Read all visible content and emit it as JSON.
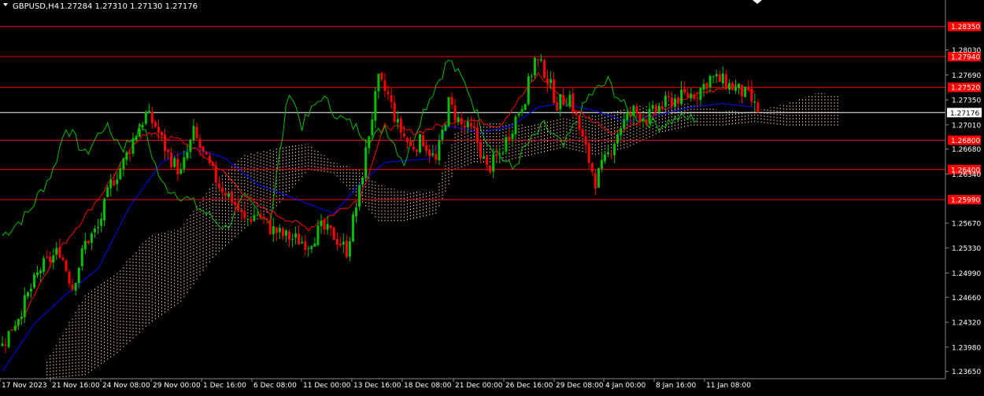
{
  "header": {
    "symbol": "GBPUSD,H4",
    "ohlc": "1.27284 1.27310 1.27130 1.27176"
  },
  "colors": {
    "background": "#000000",
    "bull": "#00c000",
    "bear": "#ff0000",
    "tenkan": "#ff0000",
    "kijun": "#0000ff",
    "chikou": "#00c000",
    "cloud": "#ffd2b4",
    "level": "#ff0000",
    "price_line": "#ffffff",
    "axis_text": "#ffffff"
  },
  "chart_data": {
    "type": "candlestick",
    "y_range": [
      1.2355,
      1.2855
    ],
    "price_ticks": [
      "1.28030",
      "1.27690",
      "1.27350",
      "1.27010",
      "1.26680",
      "1.26340",
      "1.25670",
      "1.25330",
      "1.24990",
      "1.24660",
      "1.24320",
      "1.23980",
      "1.23650"
    ],
    "levels": [
      {
        "price": 1.2835,
        "label": "1.28350"
      },
      {
        "price": 1.2794,
        "label": "1.27940"
      },
      {
        "price": 1.2752,
        "label": "1.27520"
      },
      {
        "price": 1.268,
        "label": "1.26800"
      },
      {
        "price": 1.264,
        "label": "1.26400"
      },
      {
        "price": 1.2599,
        "label": "1.25990"
      }
    ],
    "current_price": {
      "price": 1.27176,
      "label": "1.27176"
    },
    "time_labels": [
      "17 Nov 2023",
      "21 Nov 16:00",
      "24 Nov 08:00",
      "29 Nov 00:00",
      "1 Dec 16:00",
      "6 Dec 08:00",
      "11 Dec 00:00",
      "13 Dec 16:00",
      "18 Dec 08:00",
      "21 Dec 00:00",
      "26 Dec 16:00",
      "29 Dec 08:00",
      "4 Jan 00:00",
      "8 Jan 16:00",
      "11 Jan 08:00"
    ],
    "anchors": [
      [
        0,
        1.24
      ],
      [
        6,
        1.245
      ],
      [
        12,
        1.2505
      ],
      [
        18,
        1.253
      ],
      [
        22,
        1.248
      ],
      [
        26,
        1.254
      ],
      [
        30,
        1.256
      ],
      [
        34,
        1.262
      ],
      [
        38,
        1.265
      ],
      [
        42,
        1.269
      ],
      [
        45,
        1.2715
      ],
      [
        48,
        1.27
      ],
      [
        52,
        1.266
      ],
      [
        56,
        1.2635
      ],
      [
        60,
        1.269
      ],
      [
        64,
        1.265
      ],
      [
        68,
        1.262
      ],
      [
        72,
        1.26
      ],
      [
        76,
        1.257
      ],
      [
        80,
        1.258
      ],
      [
        84,
        1.256
      ],
      [
        88,
        1.255
      ],
      [
        92,
        1.2545
      ],
      [
        96,
        1.254
      ],
      [
        100,
        1.256
      ],
      [
        104,
        1.255
      ],
      [
        108,
        1.253
      ],
      [
        112,
        1.261
      ],
      [
        115,
        1.269
      ],
      [
        118,
        1.276
      ],
      [
        121,
        1.274
      ],
      [
        124,
        1.27
      ],
      [
        128,
        1.267
      ],
      [
        132,
        1.268
      ],
      [
        136,
        1.265
      ],
      [
        140,
        1.273
      ],
      [
        144,
        1.27
      ],
      [
        148,
        1.269
      ],
      [
        152,
        1.264
      ],
      [
        156,
        1.266
      ],
      [
        160,
        1.27
      ],
      [
        164,
        1.274
      ],
      [
        167,
        1.279
      ],
      [
        170,
        1.2775
      ],
      [
        174,
        1.273
      ],
      [
        178,
        1.274
      ],
      [
        182,
        1.268
      ],
      [
        186,
        1.2625
      ],
      [
        190,
        1.266
      ],
      [
        194,
        1.27
      ],
      [
        198,
        1.272
      ],
      [
        202,
        1.271
      ],
      [
        206,
        1.2725
      ],
      [
        210,
        1.2735
      ],
      [
        214,
        1.274
      ],
      [
        218,
        1.2745
      ],
      [
        222,
        1.2765
      ],
      [
        226,
        1.276
      ],
      [
        230,
        1.275
      ],
      [
        234,
        1.274
      ],
      [
        237,
        1.2718
      ]
    ],
    "tenkan_anchors": [
      [
        4,
        1.242
      ],
      [
        16,
        1.252
      ],
      [
        30,
        1.26
      ],
      [
        44,
        1.269
      ],
      [
        56,
        1.268
      ],
      [
        66,
        1.265
      ],
      [
        80,
        1.259
      ],
      [
        96,
        1.256
      ],
      [
        112,
        1.26
      ],
      [
        120,
        1.27
      ],
      [
        130,
        1.269
      ],
      [
        144,
        1.271
      ],
      [
        156,
        1.27
      ],
      [
        168,
        1.277
      ],
      [
        180,
        1.272
      ],
      [
        192,
        1.269
      ],
      [
        204,
        1.2715
      ],
      [
        216,
        1.274
      ],
      [
        228,
        1.2755
      ],
      [
        236,
        1.2745
      ]
    ],
    "kijun_anchors": [
      [
        0,
        1.2365
      ],
      [
        10,
        1.243
      ],
      [
        20,
        1.247
      ],
      [
        30,
        1.2505
      ],
      [
        40,
        1.259
      ],
      [
        50,
        1.265
      ],
      [
        60,
        1.267
      ],
      [
        70,
        1.2655
      ],
      [
        80,
        1.262
      ],
      [
        92,
        1.26
      ],
      [
        104,
        1.258
      ],
      [
        112,
        1.262
      ],
      [
        120,
        1.265
      ],
      [
        134,
        1.2655
      ],
      [
        140,
        1.27
      ],
      [
        150,
        1.269
      ],
      [
        160,
        1.27
      ],
      [
        168,
        1.2725
      ],
      [
        176,
        1.273
      ],
      [
        186,
        1.272
      ],
      [
        196,
        1.2705
      ],
      [
        206,
        1.2715
      ],
      [
        216,
        1.2725
      ],
      [
        226,
        1.273
      ],
      [
        236,
        1.2725
      ]
    ],
    "chikou_anchors": [
      [
        0,
        1.255
      ],
      [
        8,
        1.258
      ],
      [
        16,
        1.264
      ],
      [
        20,
        1.27
      ],
      [
        26,
        1.266
      ],
      [
        32,
        1.27
      ],
      [
        38,
        1.267
      ],
      [
        44,
        1.27
      ],
      [
        50,
        1.262
      ],
      [
        58,
        1.26
      ],
      [
        64,
        1.258
      ],
      [
        70,
        1.256
      ],
      [
        76,
        1.26
      ],
      [
        84,
        1.257
      ],
      [
        90,
        1.275
      ],
      [
        94,
        1.27
      ],
      [
        100,
        1.274
      ],
      [
        106,
        1.271
      ],
      [
        110,
        1.27
      ],
      [
        116,
        1.268
      ],
      [
        120,
        1.27
      ],
      [
        126,
        1.265
      ],
      [
        132,
        1.272
      ],
      [
        140,
        1.279
      ],
      [
        146,
        1.275
      ],
      [
        152,
        1.268
      ],
      [
        160,
        1.264
      ],
      [
        164,
        1.267
      ],
      [
        170,
        1.27
      ],
      [
        176,
        1.267
      ],
      [
        184,
        1.274
      ],
      [
        190,
        1.276
      ],
      [
        196,
        1.272
      ],
      [
        200,
        1.271
      ],
      [
        206,
        1.27
      ],
      [
        212,
        1.271
      ],
      [
        218,
        1.271
      ]
    ],
    "cloud_anchors": [
      [
        14,
        1.2355,
        1.238
      ],
      [
        26,
        1.236,
        1.247
      ],
      [
        36,
        1.239,
        1.25
      ],
      [
        46,
        1.243,
        1.255
      ],
      [
        56,
        1.246,
        1.256
      ],
      [
        66,
        1.252,
        1.262
      ],
      [
        76,
        1.256,
        1.266
      ],
      [
        86,
        1.259,
        1.267
      ],
      [
        96,
        1.264,
        1.2675
      ],
      [
        104,
        1.2635,
        1.265
      ],
      [
        112,
        1.26,
        1.264
      ],
      [
        118,
        1.257,
        1.262
      ],
      [
        126,
        1.257,
        1.261
      ],
      [
        136,
        1.258,
        1.261
      ],
      [
        142,
        1.264,
        1.269
      ],
      [
        148,
        1.265,
        1.27
      ],
      [
        156,
        1.265,
        1.2705
      ],
      [
        166,
        1.266,
        1.27
      ],
      [
        176,
        1.267,
        1.271
      ],
      [
        186,
        1.266,
        1.2715
      ],
      [
        196,
        1.267,
        1.2725
      ],
      [
        206,
        1.269,
        1.273
      ],
      [
        216,
        1.27,
        1.273
      ],
      [
        226,
        1.27,
        1.272
      ],
      [
        236,
        1.2705,
        1.272
      ],
      [
        246,
        1.27,
        1.273
      ],
      [
        256,
        1.27,
        1.2745
      ],
      [
        263,
        1.27,
        1.274
      ]
    ]
  }
}
